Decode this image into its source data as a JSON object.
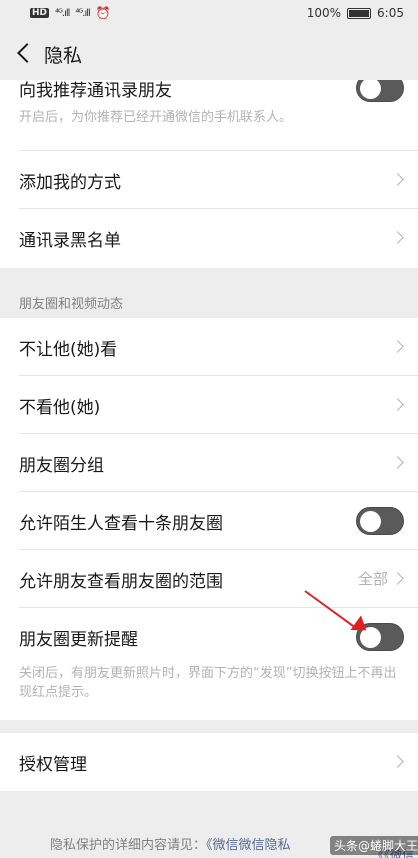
{
  "status_bar": {
    "left_icons": [
      "HD",
      "4G",
      "4G",
      "alarm-icon"
    ],
    "signal1": "⁴ᴳ.ıll",
    "signal2": "⁴ᴳ.ıll",
    "battery_pct": "100%",
    "time": "6:05"
  },
  "nav": {
    "title": "隐私"
  },
  "contacts_section": {
    "recommend_label": "向我推荐通讯录朋友",
    "recommend_enabled": false,
    "recommend_desc": "开启后，为你推荐已经开通微信的手机联系人。",
    "add_methods_label": "添加我的方式",
    "blacklist_label": "通讯录黑名单"
  },
  "moments_section": {
    "header": "朋友圈和视频动态",
    "hide_mine_label": "不让他(她)看",
    "hide_theirs_label": "不看他(她)",
    "groups_label": "朋友圈分组",
    "stranger_ten_label": "允许陌生人查看十条朋友圈",
    "stranger_ten_enabled": false,
    "range_label": "允许朋友查看朋友圈的范围",
    "range_value": "全部",
    "update_notice_label": "朋友圈更新提醒",
    "update_notice_enabled": false,
    "update_notice_desc": "关闭后，有朋友更新照片时，界面下方的“发现”切换按钮上不再出现红点提示。"
  },
  "auth_section": {
    "auth_label": "授权管理"
  },
  "footer": {
    "text": "隐私保护的详细内容请见：",
    "link1": "《微信微信隐私",
    "link2": "《《微信"
  },
  "watermark": "头条@蜷脚大王",
  "colors": {
    "background": "#ededed",
    "card": "#ffffff",
    "toggle_off": "#5a5a5a",
    "annotation_arrow": "#e02020",
    "link": "#576b95"
  }
}
